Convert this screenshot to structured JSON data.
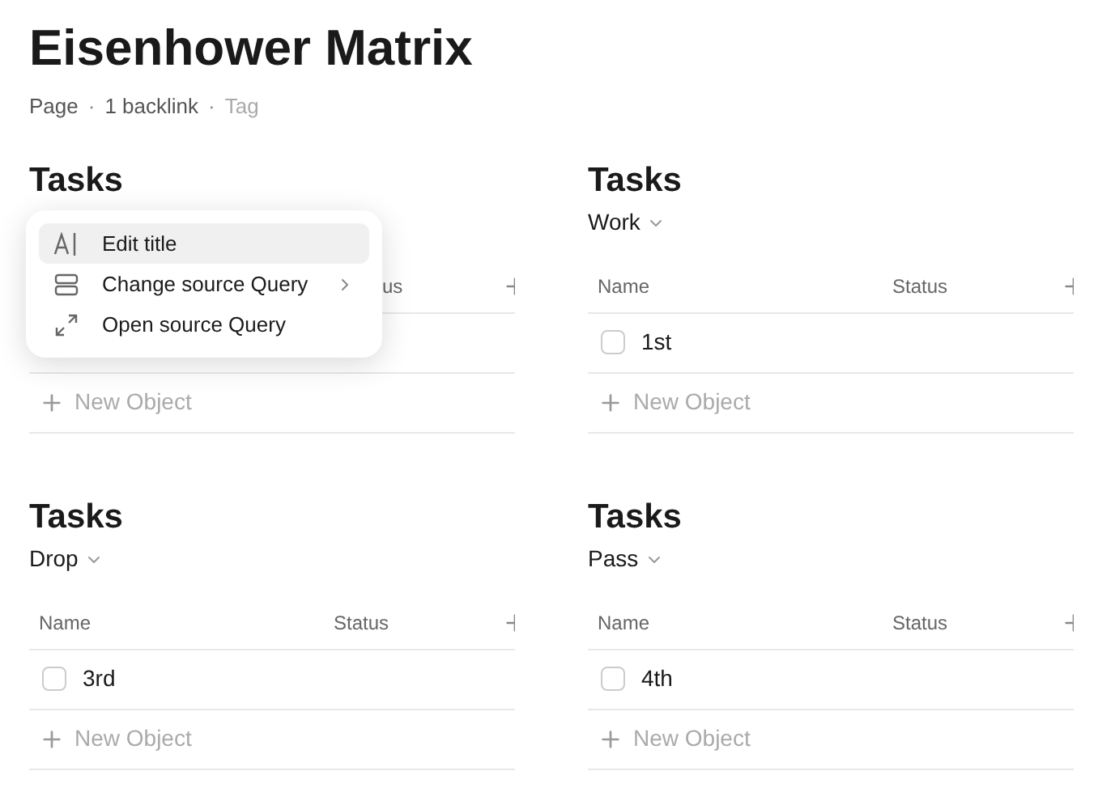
{
  "page": {
    "title": "Eisenhower Matrix",
    "meta": [
      "Page",
      "·",
      "1 backlink",
      "·",
      "Tag"
    ]
  },
  "blocks": [
    {
      "title": "Tasks",
      "columns": {
        "status": "us"
      },
      "new_label": "New Object"
    },
    {
      "title": "Tasks",
      "view": "Work",
      "columns": {
        "name": "Name",
        "status": "Status"
      },
      "rows": [
        {
          "name": "1st",
          "checked": false
        }
      ],
      "new_label": "New Object"
    },
    {
      "title": "Tasks",
      "view": "Drop",
      "columns": {
        "name": "Name",
        "status": "Status"
      },
      "rows": [
        {
          "name": "3rd",
          "checked": false
        }
      ],
      "new_label": "New Object"
    },
    {
      "title": "Tasks",
      "view": "Pass",
      "columns": {
        "name": "Name",
        "status": "Status"
      },
      "rows": [
        {
          "name": "4th",
          "checked": false
        }
      ],
      "new_label": "New Object"
    }
  ],
  "menu": {
    "items": [
      {
        "label": "Edit title",
        "kind": "title",
        "selected": true,
        "submenu": false
      },
      {
        "label": "Change source Query",
        "kind": "source",
        "selected": false,
        "submenu": true
      },
      {
        "label": "Open source Query",
        "kind": "open",
        "selected": false,
        "submenu": false
      }
    ]
  }
}
